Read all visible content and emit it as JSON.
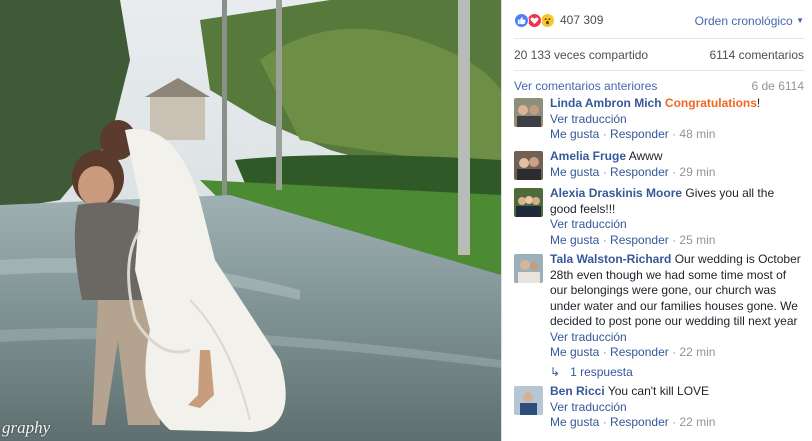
{
  "photo": {
    "watermark": "graphy"
  },
  "panel": {
    "reactions": {
      "icons": [
        "like-icon",
        "love-icon",
        "wow-icon"
      ],
      "count": "407 309"
    },
    "order_label": "Orden cronológico",
    "shared_label": "20 133 veces compartido",
    "comments_count_label": "6114 comentarios",
    "previous_label": "Ver comentarios anteriores",
    "page_label": "6 de 6114",
    "comments": [
      {
        "author": "Linda Ambron Mich",
        "text": "Congratulations",
        "text_suffix": "!",
        "translate": "Ver traducción",
        "like": "Me gusta",
        "reply": "Responder",
        "time": "48 min"
      },
      {
        "author": "Amelia Fruge",
        "text": "Awww",
        "like": "Me gusta",
        "reply": "Responder",
        "time": "29 min"
      },
      {
        "author": "Alexia Draskinis Moore",
        "text": "Gives you all the good feels!!!",
        "translate": "Ver traducción",
        "like": "Me gusta",
        "reply": "Responder",
        "time": "25 min"
      },
      {
        "author": "Tala Walston-Richard",
        "text": "Our wedding is October 28th even though we had some time most of our belongings were gone, our church was under water and our families houses gone. We decided to post pone our wedding till next year",
        "translate": "Ver traducción",
        "like": "Me gusta",
        "reply": "Responder",
        "time": "22 min",
        "replies": "1 respuesta"
      },
      {
        "author": "Ben Ricci",
        "text": "You can't kill LOVE",
        "translate": "Ver traducción",
        "like": "Me gusta",
        "reply": "Responder",
        "time": "22 min"
      }
    ]
  }
}
